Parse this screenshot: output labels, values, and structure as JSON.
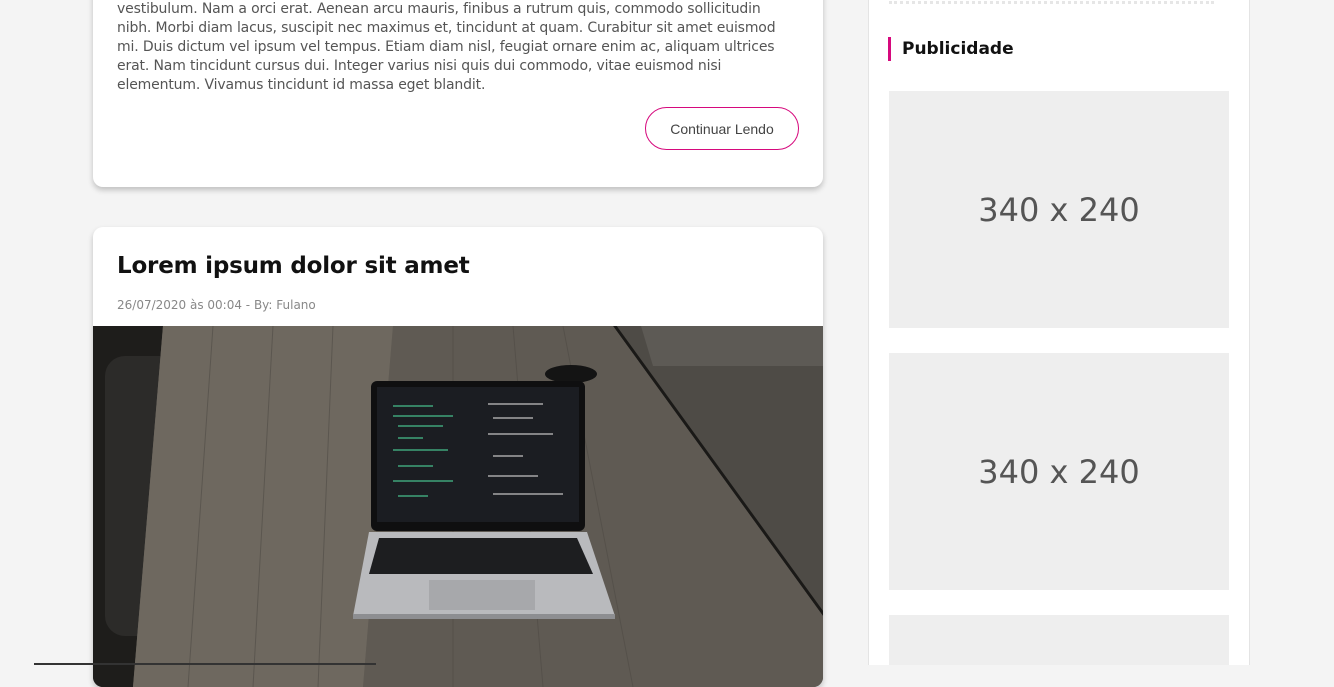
{
  "posts": [
    {
      "excerpt": "vestibulum. Nam a orci erat. Aenean arcu mauris, finibus a rutrum quis, commodo sollicitudin nibh. Morbi diam lacus, suscipit nec maximus et, tincidunt at quam. Curabitur sit amet euismod mi. Duis dictum vel ipsum vel tempus. Etiam diam nisl, feugiat ornare enim ac, aliquam ultrices erat. Nam tincidunt cursus dui. Integer varius nisi quis dui commodo, vitae euismod nisi elementum. Vivamus tincidunt id massa eget blandit.",
      "read_more_label": "Continuar Lendo"
    },
    {
      "title": "Lorem ipsum dolor sit amet",
      "meta": "26/07/2020 às 00:04 - By: Fulano",
      "image_subject": "laptop with code editor on wooden table"
    }
  ],
  "sidebar": {
    "widget_title": "Publicidade",
    "ads": [
      {
        "label": "340 x 240"
      },
      {
        "label": "340 x 240"
      },
      {
        "label": ""
      }
    ]
  },
  "colors": {
    "accent": "#d6097d",
    "page_background": "#f4f4f4",
    "card_background": "#ffffff",
    "ad_background": "#eeeeee"
  }
}
